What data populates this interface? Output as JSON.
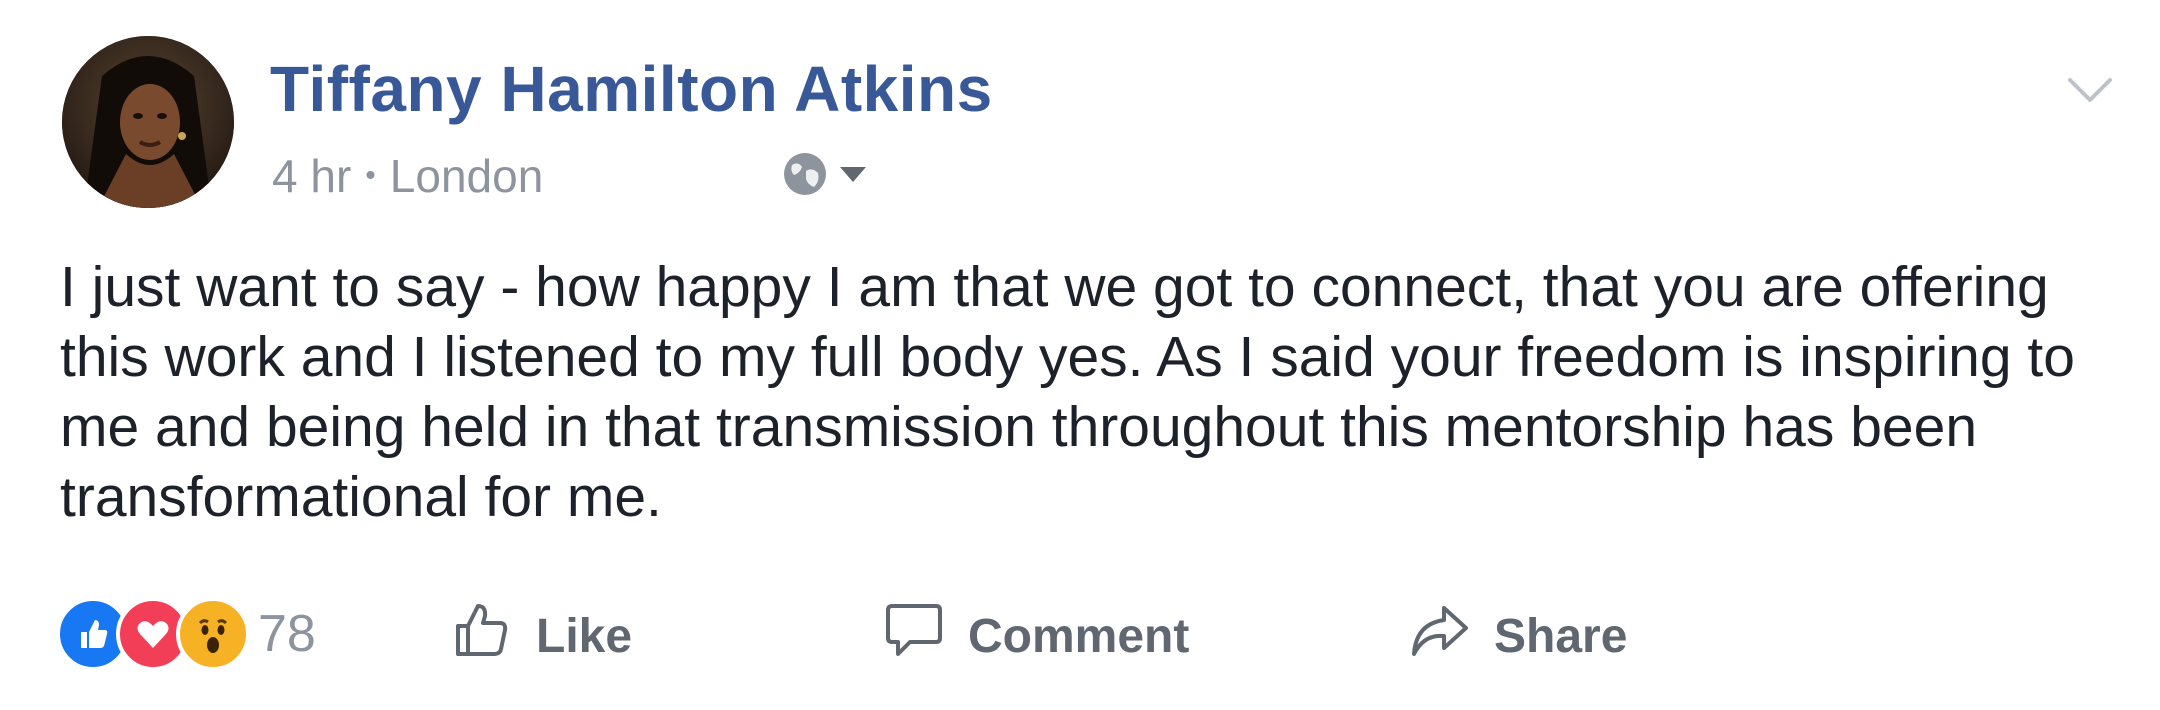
{
  "post": {
    "author_name": "Tiffany Hamilton Atkins",
    "time": "4 hr",
    "separator": "•",
    "location": "London",
    "privacy_icon": "globe-icon",
    "body": "I just want to say - how happy I am that we got to connect, that you are offering this work and I listened to my full body yes. As I said your freedom is inspiring to me and being held in that transmission throughout this mentorship has been transformational for me."
  },
  "reactions": {
    "icons": [
      "like-reaction-icon",
      "love-reaction-icon",
      "wow-reaction-icon"
    ],
    "count": "78"
  },
  "actions": {
    "like_label": "Like",
    "comment_label": "Comment",
    "share_label": "Share"
  },
  "colors": {
    "name_blue": "#385898",
    "meta_gray": "#8d949e",
    "action_gray": "#606770",
    "like_blue": "#1877f2",
    "love_red": "#f33e58",
    "wow_yellow": "#f7b125"
  }
}
